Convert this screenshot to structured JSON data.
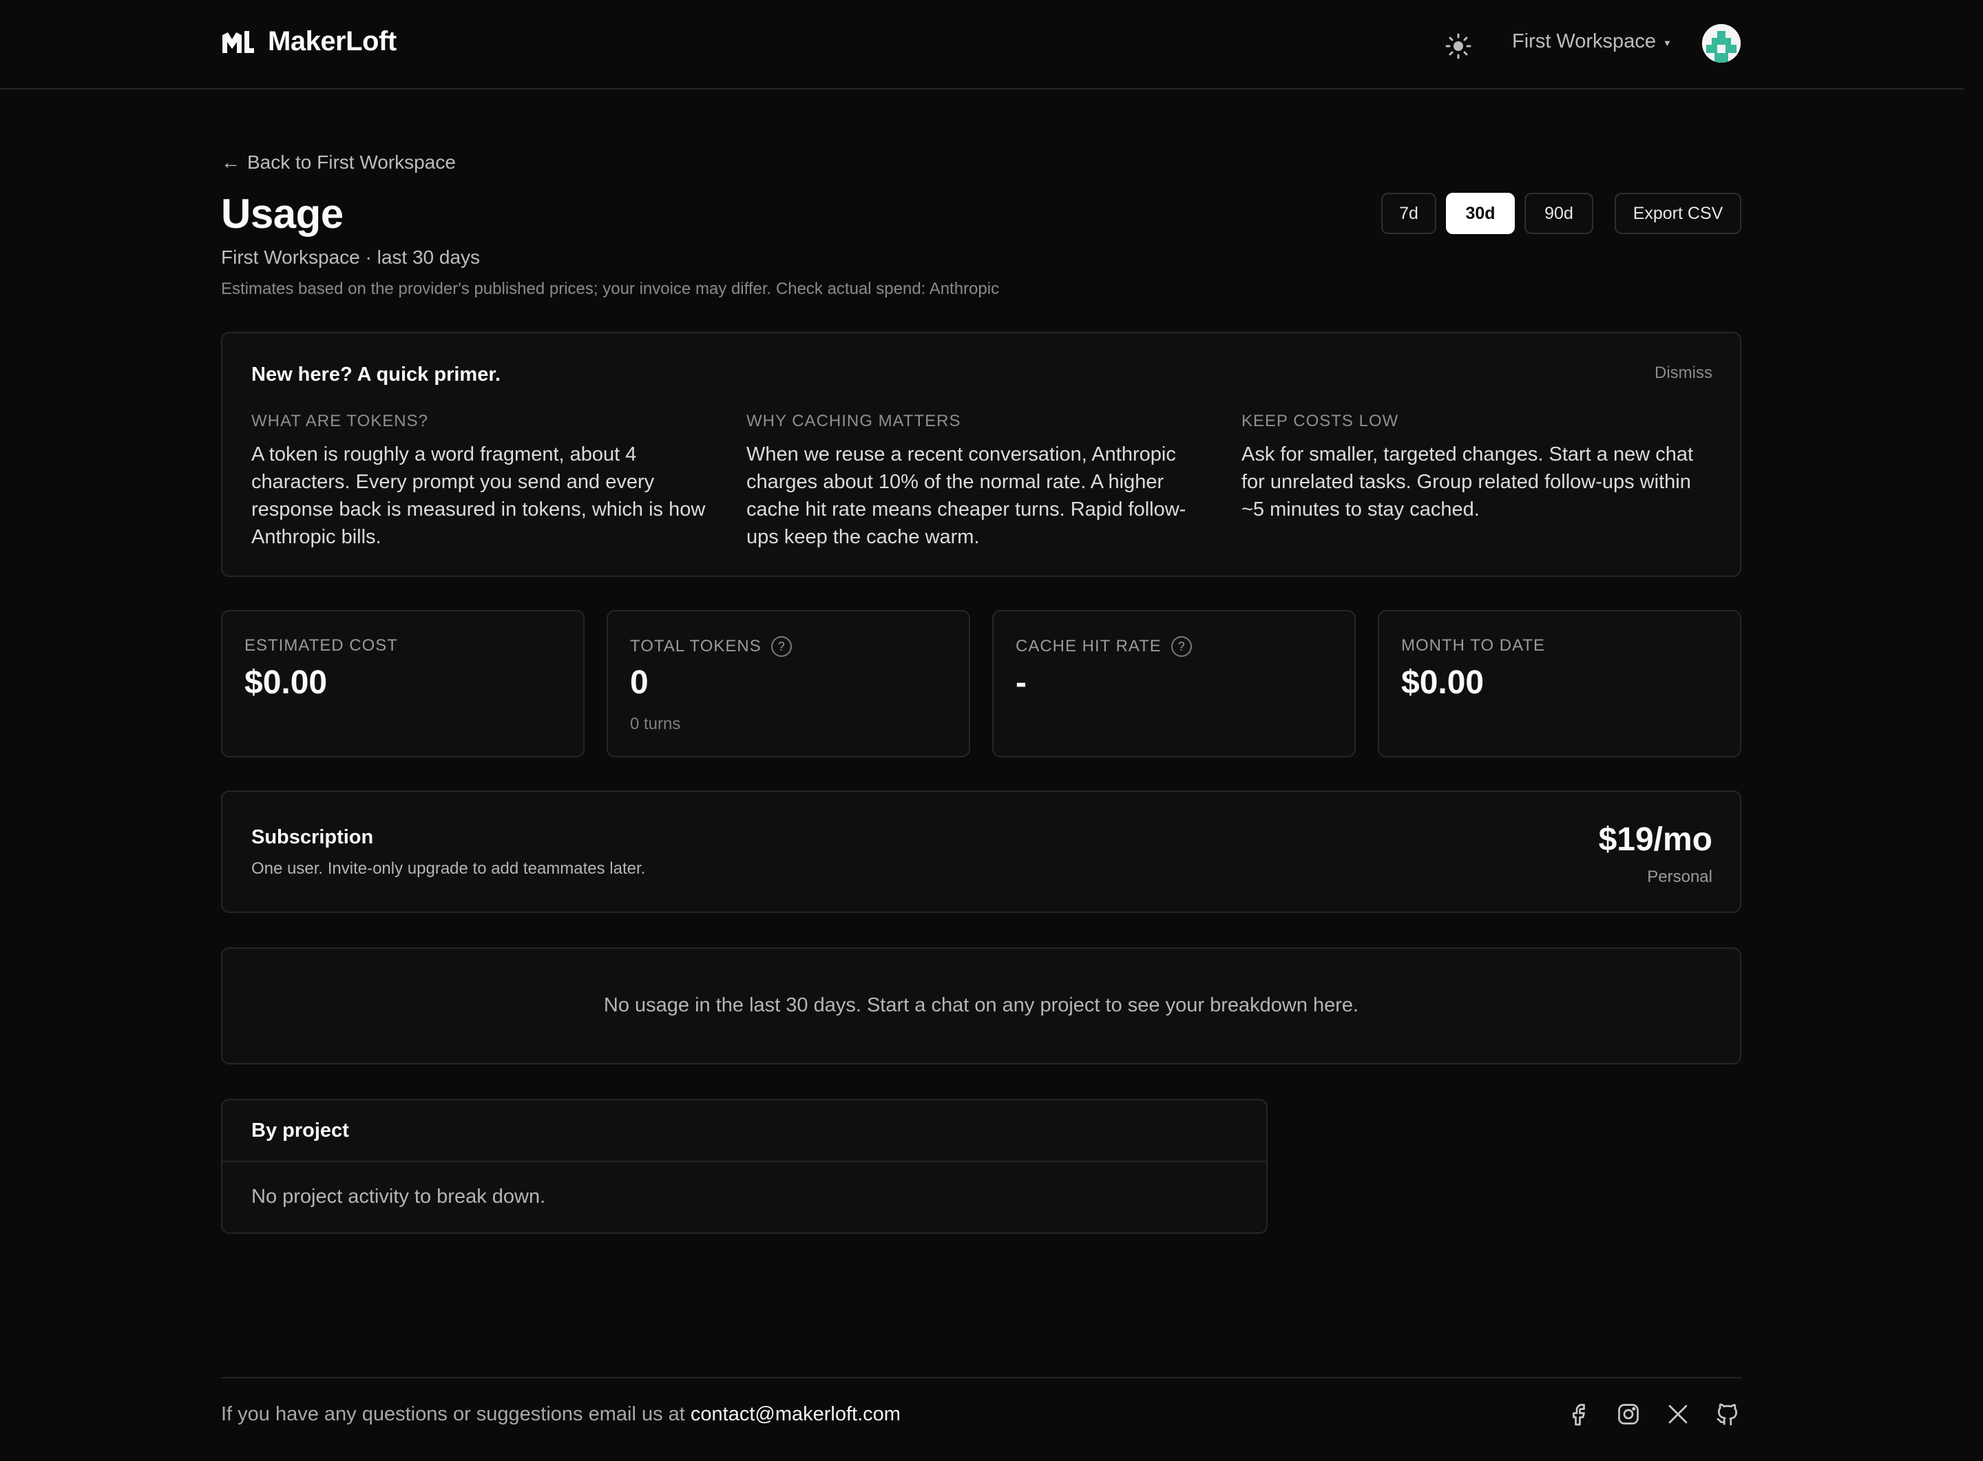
{
  "header": {
    "brand": "MakerLoft",
    "workspace": "First Workspace"
  },
  "page": {
    "back_link": "Back to First Workspace",
    "title": "Usage",
    "subtitle": "First Workspace · last 30 days",
    "note": "Estimates based on the provider's published prices; your invoice may differ.  Check actual spend: Anthropic"
  },
  "range": {
    "options": [
      "7d",
      "30d",
      "90d"
    ],
    "selected": "30d",
    "export_label": "Export CSV"
  },
  "primer": {
    "title": "New here? A quick primer.",
    "dismiss": "Dismiss",
    "columns": [
      {
        "heading": "WHAT ARE TOKENS?",
        "body": "A token is roughly a word fragment, about 4 characters. Every prompt you send and every response back is measured in tokens, which is how Anthropic bills."
      },
      {
        "heading": "WHY CACHING MATTERS",
        "body": "When we reuse a recent conversation, Anthropic charges about 10% of the normal rate. A higher cache hit rate means cheaper turns. Rapid follow-ups keep the cache warm."
      },
      {
        "heading": "KEEP COSTS LOW",
        "body": "Ask for smaller, targeted changes. Start a new chat for unrelated tasks. Group related follow-ups within ~5 minutes to stay cached."
      }
    ]
  },
  "stats": [
    {
      "label": "ESTIMATED COST",
      "value": "$0.00",
      "sub": "",
      "help": false
    },
    {
      "label": "TOTAL TOKENS",
      "value": "0",
      "sub": "0 turns",
      "help": true
    },
    {
      "label": "CACHE HIT RATE",
      "value": "-",
      "sub": "",
      "help": true
    },
    {
      "label": "MONTH TO DATE",
      "value": "$0.00",
      "sub": "",
      "help": false
    }
  ],
  "subscription": {
    "title": "Subscription",
    "description": "One user. Invite-only upgrade to add teammates later.",
    "price": "$19/mo",
    "plan": "Personal"
  },
  "empty_state": "No usage in the last 30 days. Start a chat on any project to see your breakdown here.",
  "by_project": {
    "title": "By project",
    "empty": "No project activity to break down."
  },
  "footer": {
    "text": "If you have any questions or suggestions email us at ",
    "email": "contact@makerloft.com",
    "social": [
      "facebook-icon",
      "instagram-icon",
      "x-icon",
      "github-icon"
    ]
  }
}
